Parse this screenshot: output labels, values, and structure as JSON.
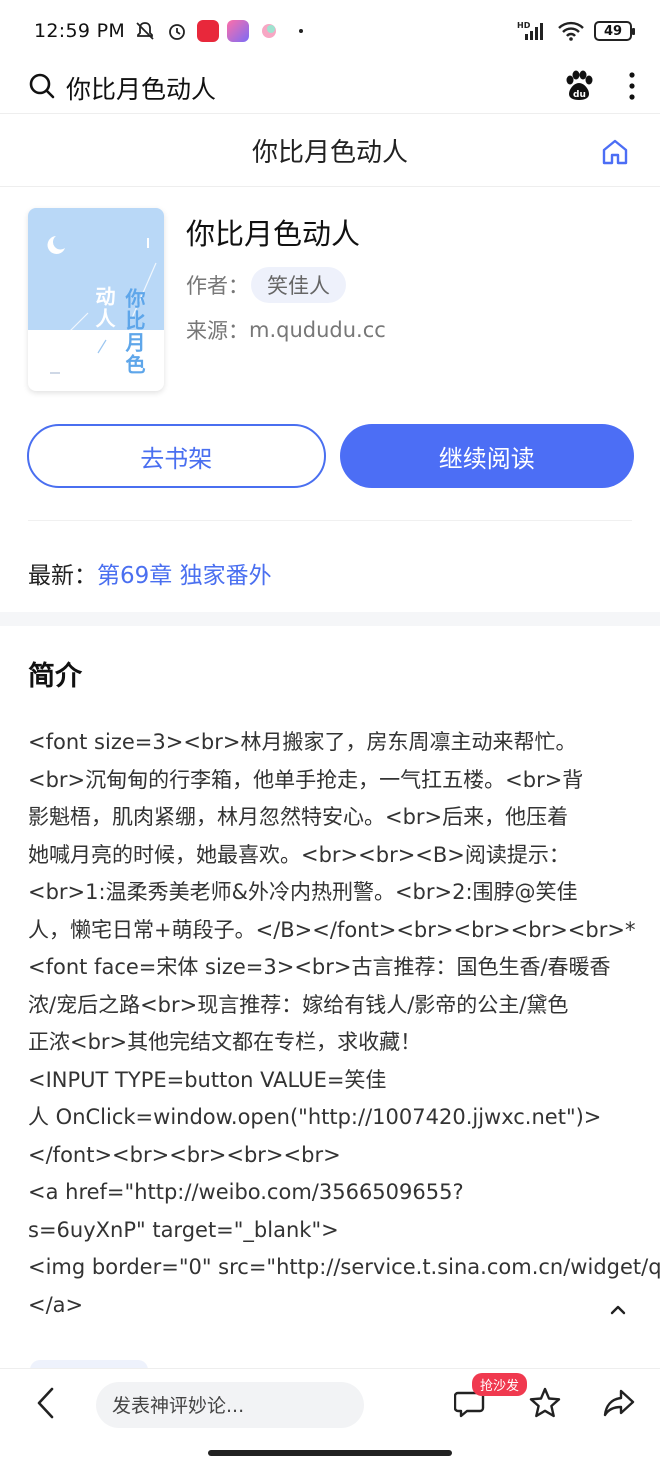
{
  "status_bar": {
    "time": "12:59 PM",
    "battery": "49",
    "network": "HD"
  },
  "search": {
    "query": "你比月色动人"
  },
  "header": {
    "title": "你比月色动人"
  },
  "book": {
    "title": "你比月色动人",
    "author_label": "作者：",
    "author": "笑佳人",
    "source_label": "来源：",
    "source": "m.qududu.cc",
    "cover_title_right": "你比月色",
    "cover_title_left": "动人"
  },
  "actions": {
    "shelf_label": "去书架",
    "continue_label": "继续阅读"
  },
  "latest": {
    "label": "最新：",
    "chapter": "第69章 独家番外"
  },
  "intro": {
    "heading": "简介",
    "body": "<font size=3><br>林月搬家了，房东周凛主动来帮忙。\n<br>沉甸甸的行李箱，他单手抢走，一气扛五楼。<br>背\n影魁梧，肌肉紧绷，林月忽然特安心。<br>后来，他压着\n她喊月亮的时候，她最喜欢。<br><br><B>阅读提示：\n<br>1:温柔秀美老师&外冷内热刑警。<br>2:围脖@笑佳\n人，懒宅日常+萌段子。</B></font><br><br><br><br>*\n<font face=宋体 size=3><br>古言推荐：国色生香/春暖香\n浓/宠后之路<br>现言推荐：嫁给有钱人/影帝的公主/黛色\n正浓<br>其他完结文都在专栏，求收藏！\n<INPUT TYPE=button VALUE=笑佳\n人 OnClick=window.open(\"http://1007420.jjwxc.net\")>\n</font><br><br><br><br>\n<a href=\"http://weibo.com/3566509655?\ns=6uyXnP\" target=\"_blank\">\n<img border=\"0\" src=\"http://service.t.sina.com.cn/widget/q\n</a>"
  },
  "bottom_bar": {
    "comment_placeholder": "发表神评妙论...",
    "sofa_badge": "抢沙发"
  },
  "colors": {
    "accent": "#4c6ef5",
    "badge": "#f0394f"
  }
}
